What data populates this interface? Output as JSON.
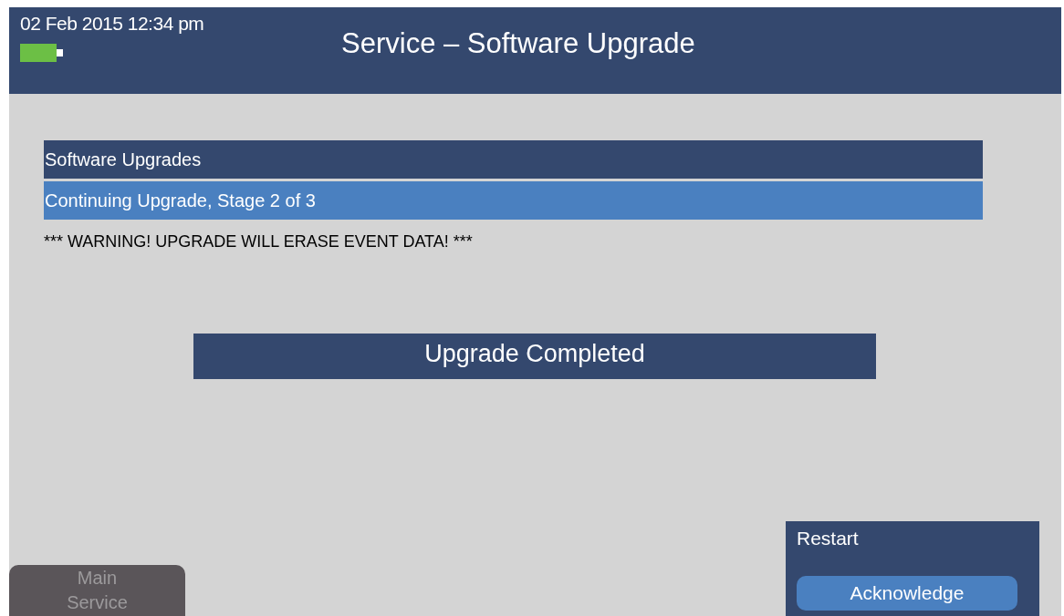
{
  "header": {
    "datetime": "02 Feb 2015 12:34 pm",
    "title": "Service – Software Upgrade"
  },
  "list": {
    "title": "Software Upgrades",
    "items": [
      {
        "label": "Continuing Upgrade, Stage 2 of 3",
        "selected": true
      }
    ]
  },
  "warning": "*** WARNING! UPGRADE WILL ERASE EVENT DATA! ***",
  "status": "Upgrade Completed",
  "nav_button": {
    "lines": [
      "Main",
      "Service"
    ],
    "disabled": true
  },
  "action_panel": {
    "title": "Restart",
    "button": "Acknowledge"
  }
}
